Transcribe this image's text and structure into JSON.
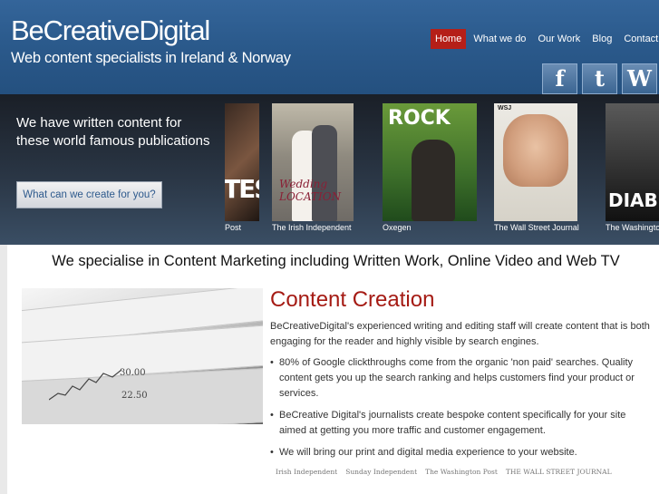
{
  "header": {
    "logo": "BeCreativeDigital",
    "tagline": "Web content specialists in Ireland & Norway",
    "nav": [
      {
        "label": "Home",
        "active": true
      },
      {
        "label": "What we do",
        "active": false
      },
      {
        "label": "Our Work",
        "active": false
      },
      {
        "label": "Blog",
        "active": false
      },
      {
        "label": "Contact",
        "active": false
      }
    ],
    "social": [
      {
        "icon": "facebook-icon",
        "glyph": "f"
      },
      {
        "icon": "twitter-icon",
        "glyph": "t"
      },
      {
        "icon": "wordpress-icon",
        "glyph": "W"
      }
    ],
    "active_color": "#b51f18"
  },
  "banner": {
    "text": "We have written content for these world famous publications",
    "cta": "What can we create for you?",
    "magazines": [
      {
        "label": "Post",
        "cover_text": "TES"
      },
      {
        "label": "The Irish Independent",
        "cover_text": "Wedding LOCATION"
      },
      {
        "label": "Oxegen",
        "cover_text": "ROCK"
      },
      {
        "label": "The Wall Street Journal",
        "cover_text": "WSJ"
      },
      {
        "label": "The Washingto",
        "cover_text": "DIABE"
      }
    ]
  },
  "main": {
    "headline": "We specialise in Content Marketing including Written Work, Online Video and Web TV",
    "title": "Content Creation",
    "lead": "BeCreativeDigital's experienced writing and editing staff will create content that is both engaging for the reader and highly visible by search engines.",
    "bullets": [
      "80% of Google clickthroughs come from the organic 'non paid' searches. Quality content gets you up the search ranking and helps customers find your product or services.",
      "BeCreative Digital's journalists create bespoke content specifically for your site aimed at getting you more traffic and customer engagement.",
      "We will bring our print and digital media experience to your website."
    ],
    "photo_numbers": [
      "30.00",
      "22.50"
    ],
    "logos": [
      "Irish Independent",
      "Sunday Independent",
      "The Washington Post",
      "THE WALL STREET JOURNAL"
    ],
    "title_color": "#a51b14"
  }
}
